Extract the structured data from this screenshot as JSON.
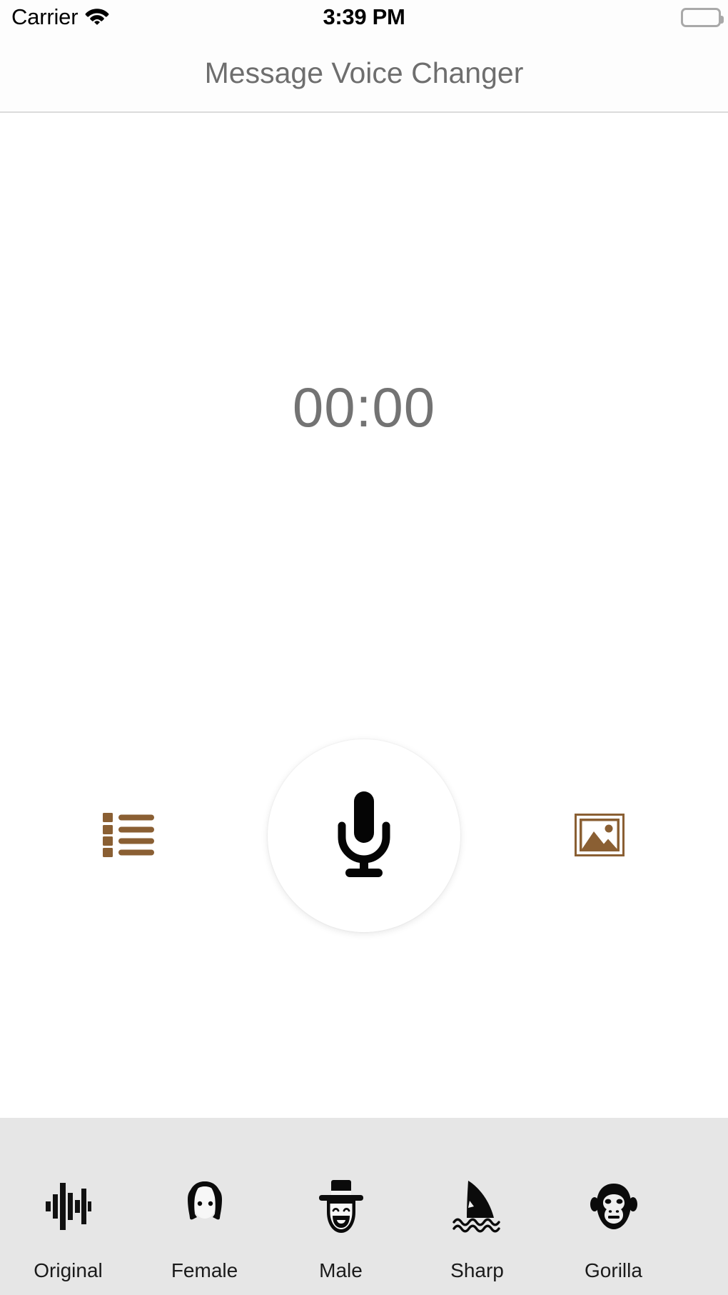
{
  "status_bar": {
    "carrier": "Carrier",
    "wifi_icon": "wifi-icon",
    "time": "3:39 PM",
    "battery_icon": "battery-full-icon"
  },
  "nav": {
    "title": "Message Voice Changer"
  },
  "main": {
    "timer": "00:00",
    "left_button_icon": "list-icon",
    "record_button_icon": "microphone-icon",
    "right_button_icon": "image-icon"
  },
  "theme": {
    "accent_brown": "#8a5f33",
    "timer_gray": "#737373",
    "nav_title_gray": "#6e6e6e",
    "voice_bar_bg": "#e6e6e6",
    "page_bg": "#ffffff",
    "icon_black": "#111111"
  },
  "voice_bar": {
    "items": [
      {
        "label": "Original",
        "icon": "waveform-icon"
      },
      {
        "label": "Female",
        "icon": "female-face-icon"
      },
      {
        "label": "Male",
        "icon": "male-tophat-face-icon"
      },
      {
        "label": "Sharp",
        "icon": "shark-fin-icon"
      },
      {
        "label": "Gorilla",
        "icon": "gorilla-face-icon"
      }
    ]
  }
}
